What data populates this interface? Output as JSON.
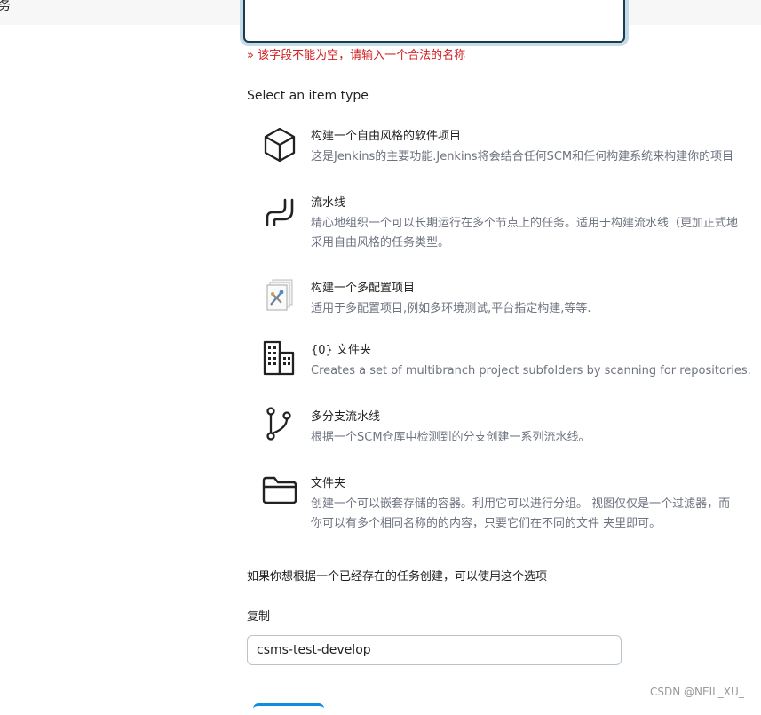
{
  "header": {
    "title": "务"
  },
  "form": {
    "name_error": "» 该字段不能为空，请输入一个合法的名称",
    "item_type_title": "Select an item type"
  },
  "item_types": [
    {
      "label": "构建一个自由风格的软件项目",
      "desc": [
        "这是Jenkins的主要功能.Jenkins将会结合任何SCM和任何构建系统来构建你的项目"
      ],
      "icon": "freestyle-icon"
    },
    {
      "label": "流水线",
      "desc": [
        "精心地组织一个可以长期运行在多个节点上的任务。适用于构建流水线（更加正式地",
        "采用自由风格的任务类型。"
      ],
      "icon": "pipeline-icon"
    },
    {
      "label": "构建一个多配置项目",
      "desc": [
        "适用于多配置项目,例如多环境测试,平台指定构建,等等."
      ],
      "icon": "multiconfig-icon"
    },
    {
      "label": "{0} 文件夹",
      "desc": [
        "Creates a set of multibranch project subfolders by scanning for repositories."
      ],
      "icon": "organization-folder-icon"
    },
    {
      "label": "多分支流水线",
      "desc": [
        "根据一个SCM仓库中检测到的分支创建一系列流水线。"
      ],
      "icon": "multibranch-icon"
    },
    {
      "label": "文件夹",
      "desc": [
        "创建一个可以嵌套存储的容器。利用它可以进行分组。 视图仅仅是一个过滤器，而",
        "你可以有多个相同名称的的内容，只要它们在不同的文件 夹里即可。"
      ],
      "icon": "folder-icon"
    }
  ],
  "copy": {
    "hint": "如果你想根据一个已经存在的任务创建，可以使用这个选项",
    "label": "复制",
    "value": "csms-test-develop"
  },
  "watermark": "CSDN @NEIL_XU_",
  "colors": {
    "error": "#d21d1d",
    "focus_ring": "#c5dbe8",
    "accent": "#138be0"
  }
}
